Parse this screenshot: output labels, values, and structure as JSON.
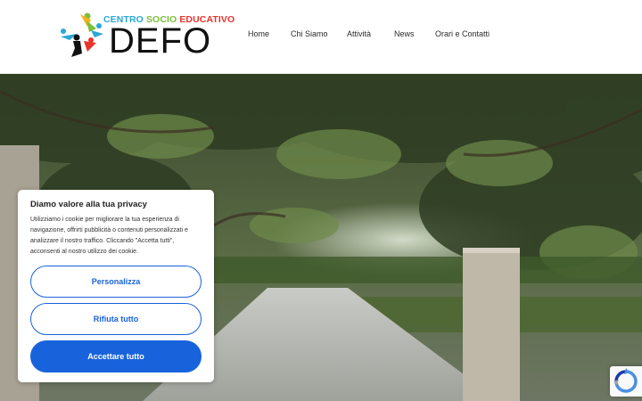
{
  "header": {
    "logo": {
      "line1_part1": "CENTRO ",
      "line1_part2": "SOCIO ",
      "line1_part3": "EDUCATIVO",
      "name": "DEFO"
    },
    "nav": [
      "Home",
      "Chi Siamo",
      "Attività",
      "News",
      "Orari e Contatti"
    ]
  },
  "cookie_banner": {
    "title": "Diamo valore alla tua privacy",
    "body": "Utilizziamo i cookie per migliorare la tua esperienza di navigazione, offrirti pubblicità o contenuti personalizzati e analizzare il nostro traffico. Cliccando \"Accetta tutti\", acconsenti al nostro utilizzo dei cookie.",
    "customize_label": "Personalizza",
    "reject_label": "Rifiuta tutto",
    "accept_label": "Accettare tutto"
  },
  "colors": {
    "accent": "#1863dc",
    "logo_blue": "#2aa7d8",
    "logo_green": "#7bbf3a",
    "logo_red": "#e8342c"
  },
  "icons": {
    "logo_mark": "people-figures-icon",
    "recaptcha": "recaptcha-icon"
  }
}
